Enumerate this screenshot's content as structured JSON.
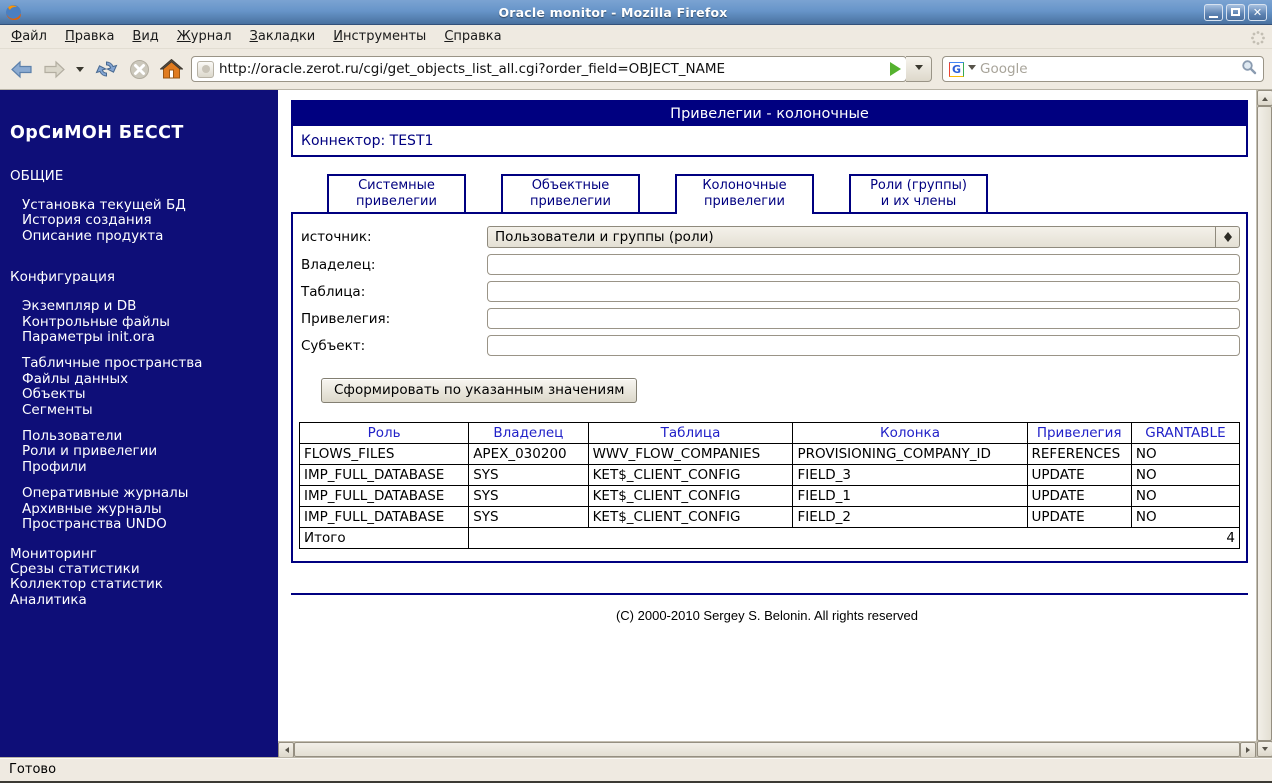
{
  "window": {
    "title": "Oracle monitor - Mozilla Firefox"
  },
  "menubar": {
    "items": [
      {
        "m": "Ф",
        "rest": "айл"
      },
      {
        "m": "П",
        "rest": "равка"
      },
      {
        "m": "В",
        "rest": "ид"
      },
      {
        "m": "Ж",
        "rest": "урнал"
      },
      {
        "m": "З",
        "rest": "акладки"
      },
      {
        "m": "И",
        "rest": "нструменты"
      },
      {
        "m": "С",
        "rest": "правка"
      }
    ]
  },
  "toolbar": {
    "url": "http://oracle.zerot.ru/cgi/get_objects_list_all.cgi?order_field=OBJECT_NAME",
    "search_placeholder": "Google"
  },
  "sidebar": {
    "brand": "ОрСиМОН БЕССТ",
    "heading1": "ОБЩИЕ",
    "group1": [
      "Установка текущей БД",
      "История создания",
      "Описание продукта"
    ],
    "heading2": "Конфигурация",
    "group2": [
      "Экземпляр и DB",
      "Контрольные файлы",
      "Параметры init.ora"
    ],
    "group3": [
      "Табличные пространства",
      "Файлы данных",
      "Объекты",
      "Сегменты"
    ],
    "group4": [
      "Пользователи",
      "Роли и привелегии",
      "Профили"
    ],
    "group5": [
      "Оперативные журналы",
      "Архивные журналы",
      "Пространства UNDO"
    ],
    "group6": [
      "Мониторинг",
      "Срезы статистики",
      "Коллектор статистик",
      "Аналитика"
    ]
  },
  "main": {
    "page_title": "Привелегии - колоночные",
    "connector": "Коннектор: TEST1",
    "tabs": [
      {
        "line1": "Системные",
        "line2": "привелегии",
        "cls": "tab"
      },
      {
        "line1": "Объектные",
        "line2": "привелегии",
        "cls": "tab"
      },
      {
        "line1": "Колоночные",
        "line2": "привелегии",
        "cls": "tab active"
      },
      {
        "line1": "Роли (группы)",
        "line2": "и их члены",
        "cls": "tab"
      }
    ],
    "form": {
      "source_label": "источник:",
      "source_value": "Пользователи и группы (роли)",
      "owner_label": "Владелец:",
      "table_label": "Таблица:",
      "privilege_label": "Привелегия:",
      "subject_label": "Субъект:"
    },
    "submit_label": "Сформировать по указанным значениям",
    "table": {
      "headers": [
        "Роль",
        "Владелец",
        "Таблица",
        "Колонка",
        "Привелегия",
        "GRANTABLE"
      ],
      "rows": [
        [
          "FLOWS_FILES",
          "APEX_030200",
          "WWV_FLOW_COMPANIES",
          "PROVISIONING_COMPANY_ID",
          "REFERENCES",
          "NO"
        ],
        [
          "IMP_FULL_DATABASE",
          "SYS",
          "KET$_CLIENT_CONFIG",
          "FIELD_3",
          "UPDATE",
          "NO"
        ],
        [
          "IMP_FULL_DATABASE",
          "SYS",
          "KET$_CLIENT_CONFIG",
          "FIELD_1",
          "UPDATE",
          "NO"
        ],
        [
          "IMP_FULL_DATABASE",
          "SYS",
          "KET$_CLIENT_CONFIG",
          "FIELD_2",
          "UPDATE",
          "NO"
        ]
      ],
      "total_label": "Итого",
      "total_value": "4"
    },
    "copyright": "(C) 2000-2010 Sergey S. Belonin. All rights reserved"
  },
  "statusbar": {
    "text": "Готово"
  }
}
